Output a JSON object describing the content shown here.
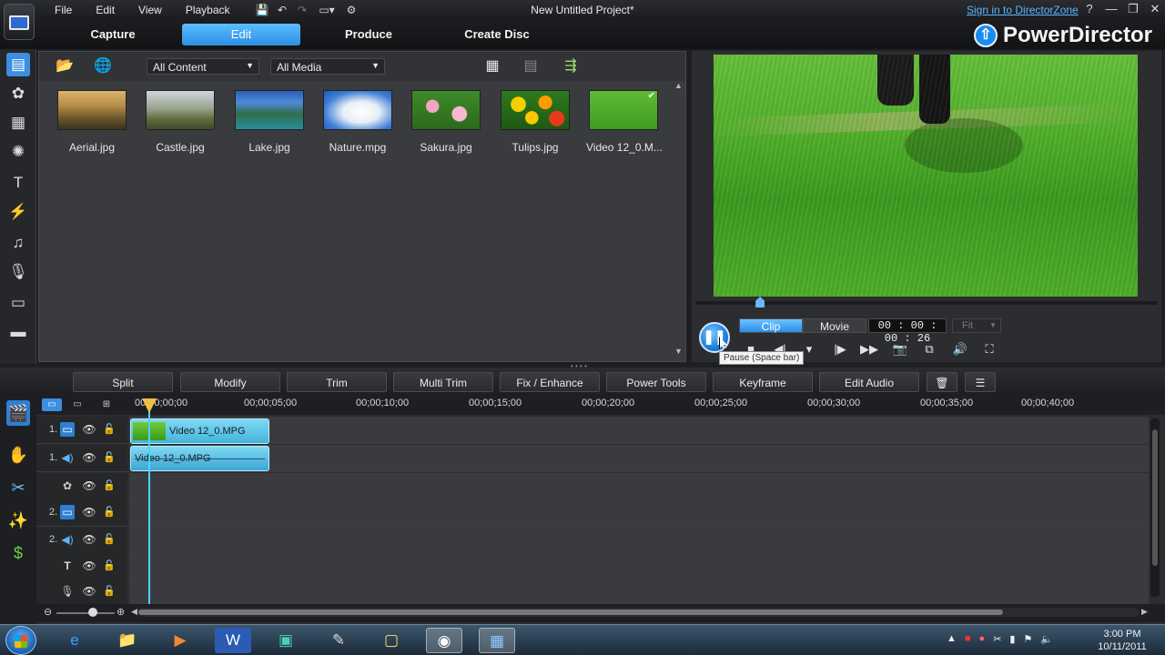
{
  "window": {
    "title": "New Untitled Project*",
    "signin": "Sign in to DirectorZone",
    "brand": "PowerDirector"
  },
  "menu": [
    "File",
    "Edit",
    "View",
    "Playback"
  ],
  "modes": [
    "Capture",
    "Edit",
    "Produce",
    "Create Disc"
  ],
  "library": {
    "filter_content": "All Content",
    "filter_media": "All Media",
    "items": [
      {
        "label": "Aerial.jpg"
      },
      {
        "label": "Castle.jpg"
      },
      {
        "label": "Lake.jpg"
      },
      {
        "label": "Nature.mpg"
      },
      {
        "label": "Sakura.jpg"
      },
      {
        "label": "Tulips.jpg"
      },
      {
        "label": "Video 12_0.M..."
      }
    ]
  },
  "preview": {
    "tab_clip": "Clip",
    "tab_movie": "Movie",
    "timecode": "00 : 00 : 00 : 26",
    "fit": "Fit",
    "tooltip": "Pause (Space bar)",
    "scrub_position": 0.14
  },
  "edit_toolbar": [
    "Split",
    "Modify",
    "Trim",
    "Multi Trim",
    "Fix / Enhance",
    "Power Tools",
    "Keyframe",
    "Edit Audio"
  ],
  "timeline": {
    "ruler": [
      "00;00;00;00",
      "00;00;05;00",
      "00;00;10;00",
      "00;00;15;00",
      "00;00;20;00",
      "00;00;25;00",
      "00;00;30;00",
      "00;00;35;00",
      "00;00;40;00"
    ],
    "tracks": [
      {
        "num": "1.",
        "kind": "video-track-icon"
      },
      {
        "num": "1.",
        "kind": "audio-track-icon"
      },
      {
        "num": "",
        "kind": "effect-track-icon"
      },
      {
        "num": "2.",
        "kind": "video-track-icon"
      },
      {
        "num": "2.",
        "kind": "audio-track-icon"
      },
      {
        "num": "",
        "kind": "title-track-icon"
      },
      {
        "num": "",
        "kind": "voice-track-icon"
      }
    ],
    "video_clip": "Video 12_0.MPG",
    "audio_clip": "Video 12_0.MPG"
  },
  "taskbar": {
    "time": "3:00 PM",
    "date": "10/11/2011"
  }
}
